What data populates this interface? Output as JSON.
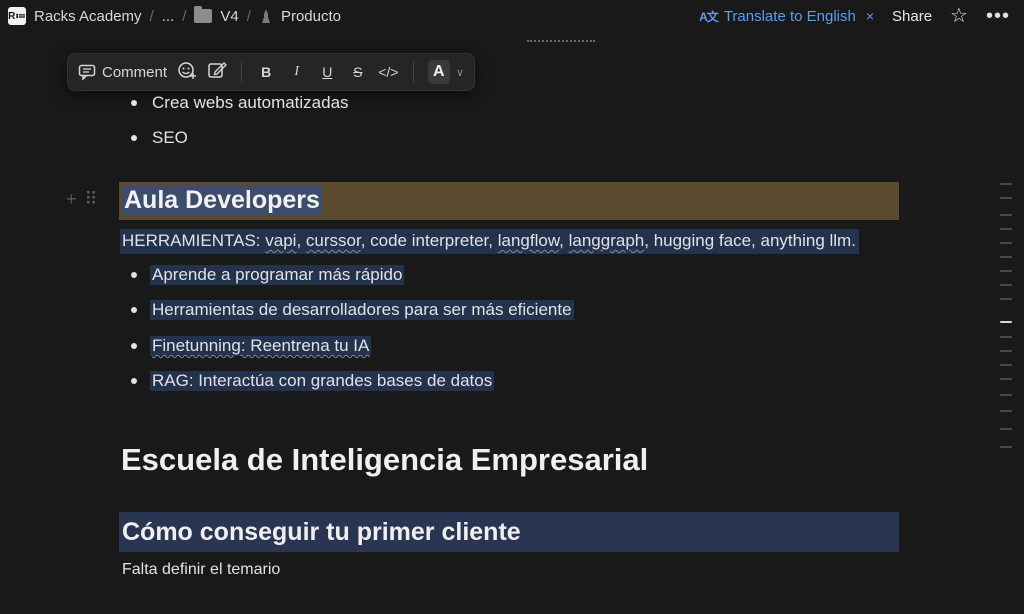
{
  "breadcrumb": {
    "logo": "R≔",
    "workspace": "Racks Academy",
    "ellipsis": "...",
    "folder": "V4",
    "page": "Producto"
  },
  "header": {
    "translate_icon": "A文",
    "translate_label": "Translate to English",
    "translate_close": "×",
    "share_label": "Share",
    "favorite_icon": "☆",
    "more_icon": "•••"
  },
  "toolbar": {
    "comment_label": "Comment",
    "bold": "B",
    "italic": "I",
    "underline": "U",
    "strike": "S",
    "code": "</>",
    "text_color": "A",
    "color_chevron": "∨"
  },
  "content": {
    "top_bullets": [
      "Crea webs automatizadas",
      "SEO"
    ],
    "aula_heading": "Aula Developers",
    "tools_prefix": "HERRAMIENTAS: ",
    "tools_list": [
      {
        "text": "vapi",
        "squiggle": true
      },
      {
        "text": ", ",
        "squiggle": false
      },
      {
        "text": "curssor",
        "squiggle": true
      },
      {
        "text": ", code interpreter, ",
        "squiggle": false
      },
      {
        "text": "langflow",
        "squiggle": true
      },
      {
        "text": ", ",
        "squiggle": false
      },
      {
        "text": "langgraph",
        "squiggle": true
      },
      {
        "text": ", hugging face, anything llm.",
        "squiggle": false
      }
    ],
    "aula_bullets": [
      "Aprende a programar más rápido",
      "Herramientas de desarrolladores para ser más eficiente",
      "Finetunning: Reentrena tu IA",
      "RAG: Interactúa con grandes bases de datos"
    ],
    "escuela_heading": "Escuela de Inteligencia Empresarial",
    "como_heading": "Cómo conseguir tu primer cliente",
    "falta_text": "Falta definir el temario"
  },
  "colors": {
    "background": "#191919",
    "aula_highlight": "#5b4b2e",
    "selection": "#23324d",
    "como_highlight": "#2a3552",
    "accent": "#5b9cf5"
  }
}
